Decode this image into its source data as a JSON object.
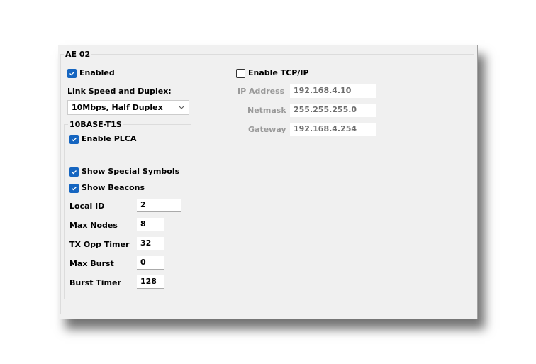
{
  "group_title": "AE 02",
  "enabled": {
    "label": "Enabled",
    "checked": true
  },
  "link_speed": {
    "label": "Link Speed and Duplex:",
    "value": "10Mbps, Half Duplex"
  },
  "t1s": {
    "title": "10BASE-T1S",
    "enable_plca": {
      "label": "Enable PLCA",
      "checked": true
    },
    "show_special_symbols": {
      "label": "Show Special Symbols",
      "checked": true
    },
    "show_beacons": {
      "label": "Show Beacons",
      "checked": true
    },
    "fields": [
      {
        "label": "Local ID",
        "value": "2"
      },
      {
        "label": "Max Nodes",
        "value": "8"
      },
      {
        "label": "TX Opp Timer",
        "value": "32"
      },
      {
        "label": "Max Burst",
        "value": "0"
      },
      {
        "label": "Burst Timer",
        "value": "128"
      }
    ]
  },
  "tcpip": {
    "enable": {
      "label": "Enable TCP/IP",
      "checked": false
    },
    "fields": [
      {
        "label": "IP Address",
        "value": "192.168.4.10"
      },
      {
        "label": "Netmask",
        "value": "255.255.255.0"
      },
      {
        "label": "Gateway",
        "value": "192.168.4.254"
      }
    ]
  },
  "colors": {
    "accent": "#1565c0",
    "disabled_text": "#9a9a9a"
  }
}
